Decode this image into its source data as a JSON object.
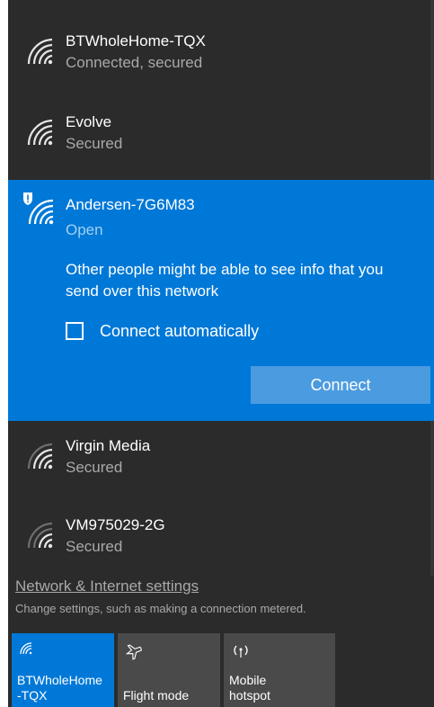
{
  "networks": [
    {
      "ssid": "BTWholeHome-TQX",
      "status": "Connected, secured"
    },
    {
      "ssid": "Evolve",
      "status": "Secured"
    },
    {
      "ssid": "Andersen-7G6M83",
      "status": "Open",
      "warning": "Other people might be able to see info that you send over this network",
      "auto_connect_label": "Connect automatically",
      "auto_connect_checked": false,
      "connect_label": "Connect"
    },
    {
      "ssid": "Virgin Media",
      "status": "Secured"
    },
    {
      "ssid": "VM975029-2G",
      "status": "Secured"
    }
  ],
  "settings": {
    "link": "Network & Internet settings",
    "description": "Change settings, such as making a connection metered."
  },
  "tiles": [
    {
      "label": "BTWholeHome\n-TQX",
      "icon": "wifi-icon",
      "active": true
    },
    {
      "label": "Flight mode",
      "icon": "airplane-icon",
      "active": false
    },
    {
      "label": "Mobile\nhotspot",
      "icon": "hotspot-icon",
      "active": false
    }
  ],
  "colors": {
    "panel_bg": "#2b2b2b",
    "accent": "#0078d7",
    "button_bg": "#4b9be0",
    "secondary_text": "#a9a9a9",
    "tile_bg": "#4a4a4a"
  }
}
